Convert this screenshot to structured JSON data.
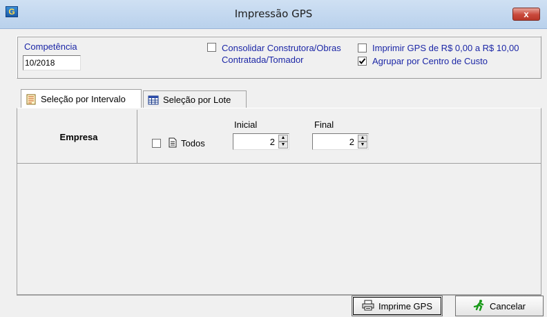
{
  "window": {
    "title": "Impressão GPS",
    "app_icon": "app-logo-icon",
    "close_icon": "close-icon",
    "close_glyph": "x"
  },
  "competencia": {
    "label": "Competência",
    "value": "10/2018"
  },
  "options": {
    "consolidar": {
      "line1": "Consolidar Construtora/Obras",
      "line2": "Contratada/Tomador",
      "checked": false
    },
    "imprimir_gps": {
      "label": "Imprimir GPS de R$ 0,00 a R$ 10,00",
      "checked": false
    },
    "agrupar": {
      "label": "Agrupar por Centro de Custo",
      "checked": true
    }
  },
  "tabs": [
    {
      "label": "Seleção por Intervalo",
      "active": true,
      "icon": "document-list-icon"
    },
    {
      "label": "Seleção por Lote",
      "active": false,
      "icon": "table-grid-icon"
    }
  ],
  "intervalo": {
    "empresa_label": "Empresa",
    "todos_label": "Todos",
    "todos_checked": false,
    "todos_icon": "document-icon",
    "inicial_label": "Inicial",
    "inicial_value": "2",
    "final_label": "Final",
    "final_value": "2"
  },
  "buttons": {
    "imprime": {
      "label": "Imprime GPS",
      "icon": "printer-icon"
    },
    "cancelar": {
      "label": "Cancelar",
      "icon": "running-man-icon"
    }
  },
  "colors": {
    "label_blue": "#1b26a6",
    "titlebar": "#b9d1ec",
    "close_red": "#c9483a",
    "cancel_green": "#1a9a1a"
  }
}
